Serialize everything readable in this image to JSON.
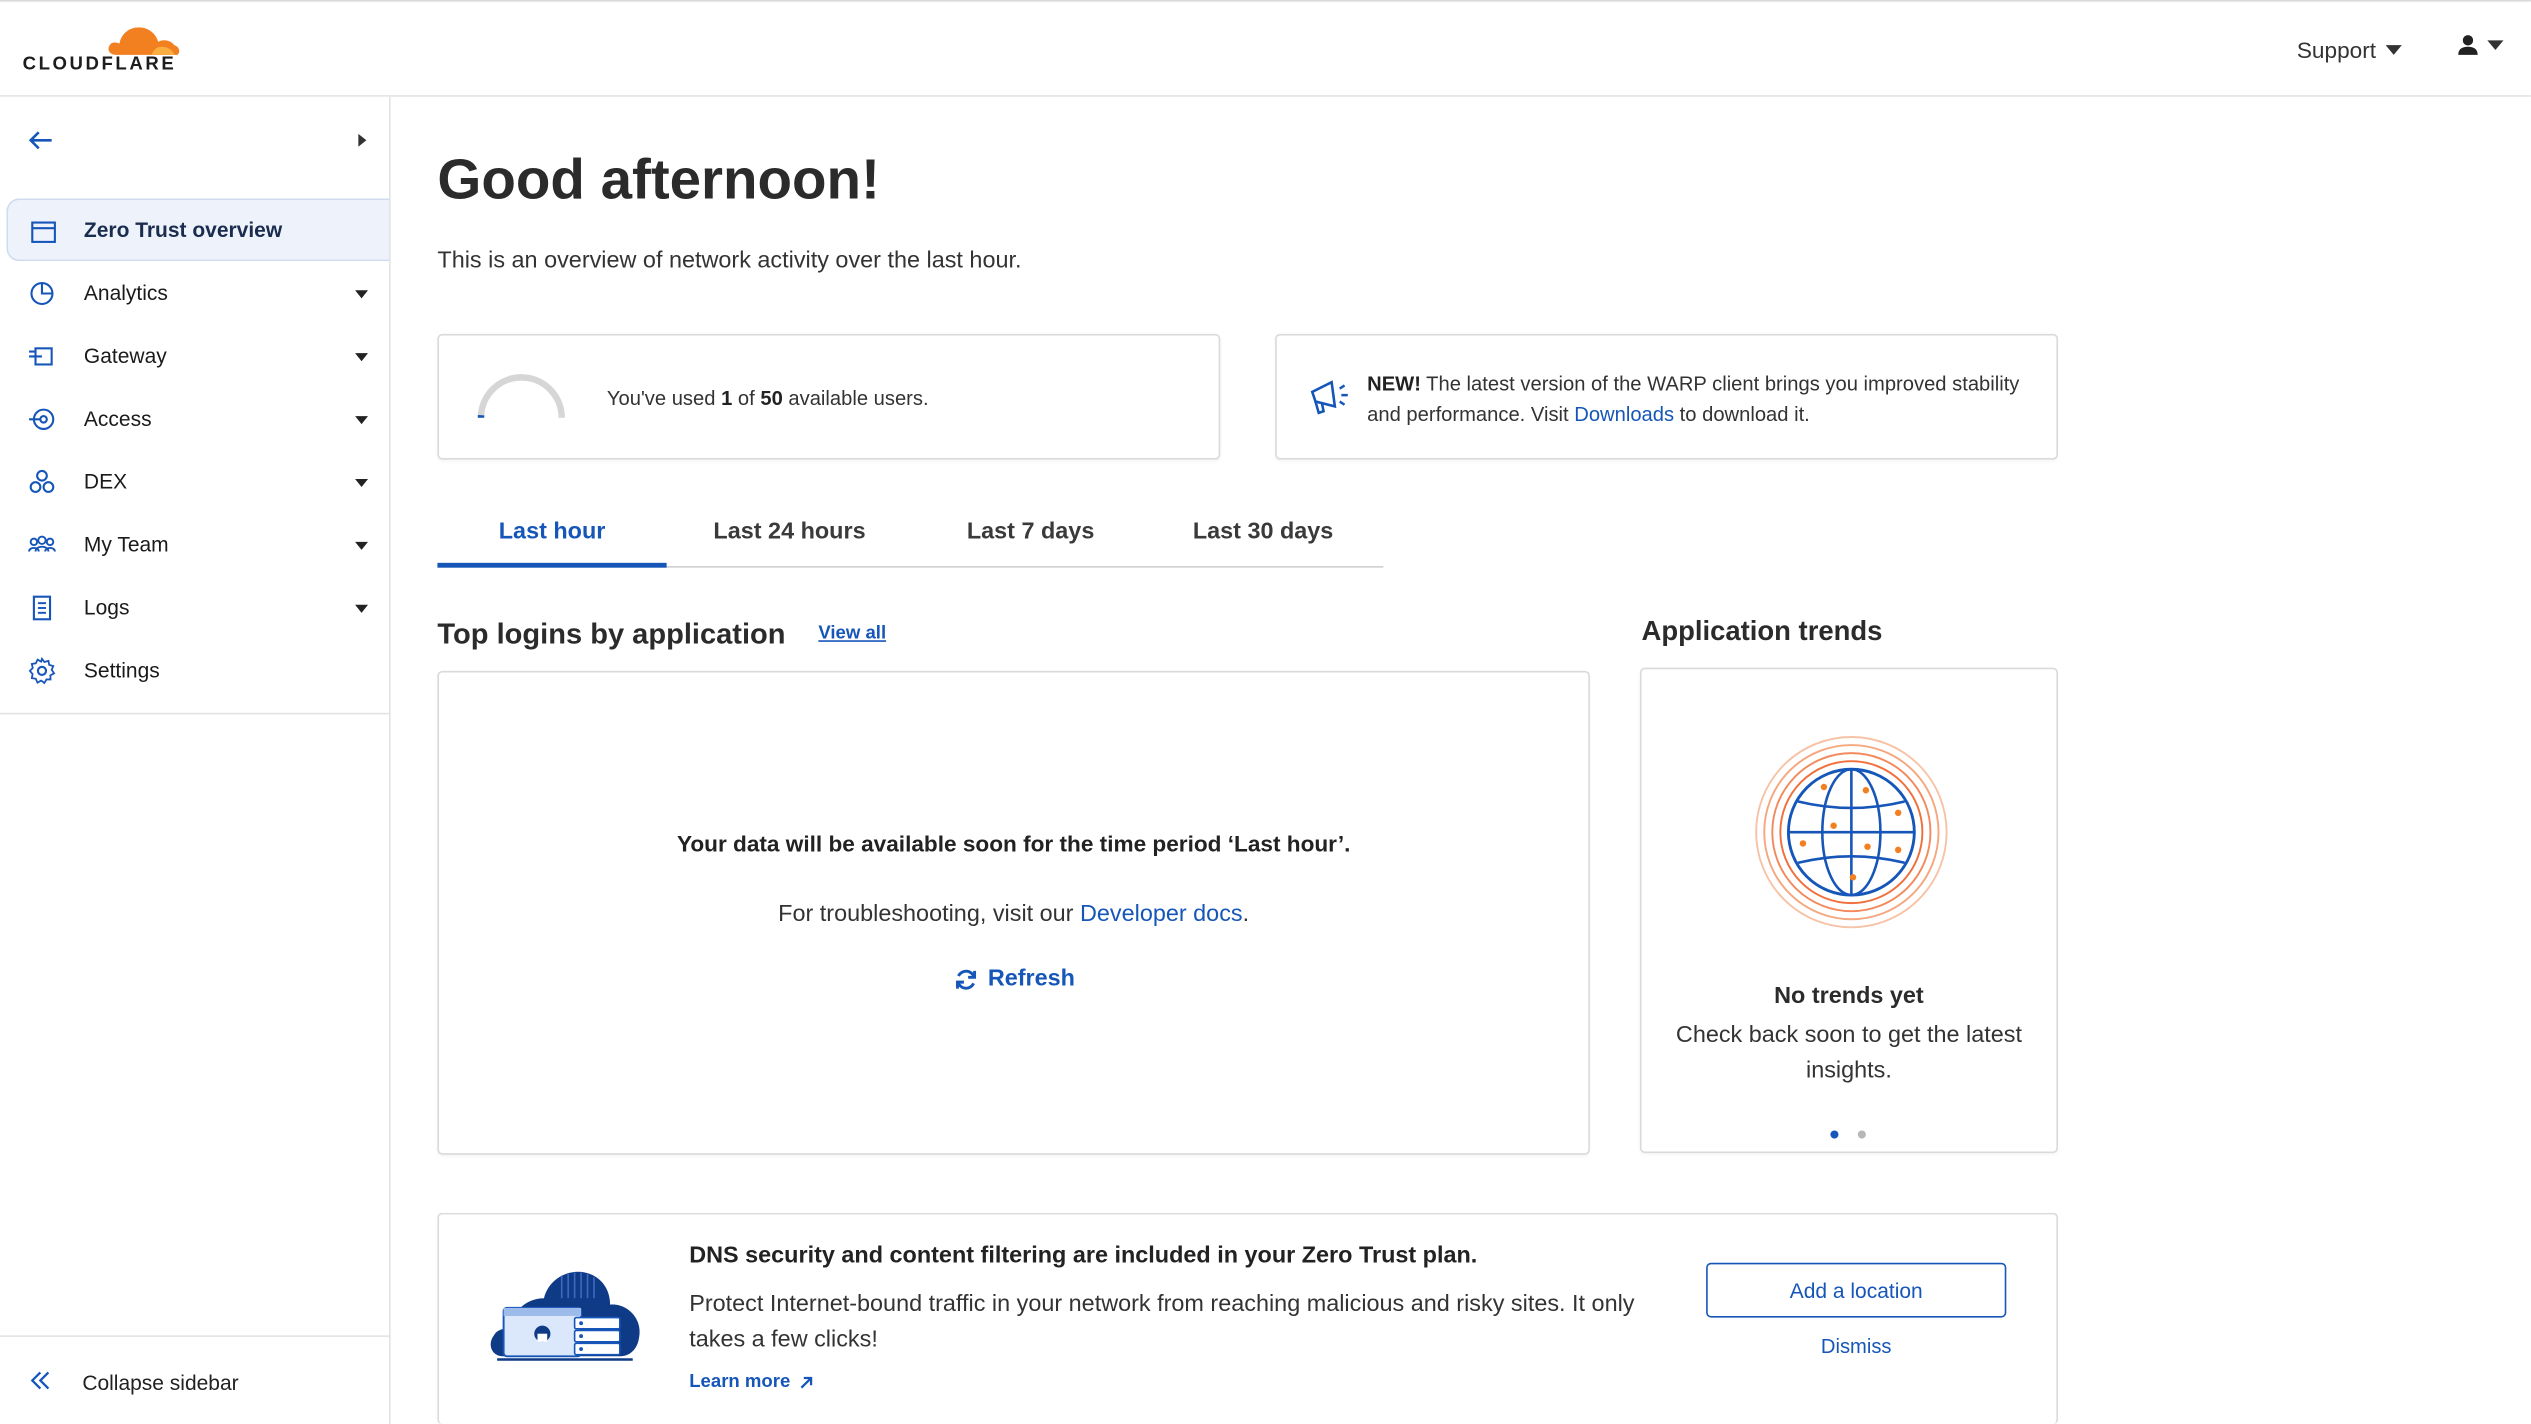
{
  "header": {
    "logo_text": "CLOUDFLARE",
    "support_label": "Support",
    "brand_color": "#f38020"
  },
  "sidebar": {
    "items": [
      {
        "label": "Zero Trust overview",
        "icon": "overview-icon",
        "active": true
      },
      {
        "label": "Analytics",
        "icon": "analytics-icon",
        "expandable": true
      },
      {
        "label": "Gateway",
        "icon": "gateway-icon",
        "expandable": true
      },
      {
        "label": "Access",
        "icon": "access-icon",
        "expandable": true
      },
      {
        "label": "DEX",
        "icon": "dex-icon",
        "expandable": true
      },
      {
        "label": "My Team",
        "icon": "team-icon",
        "expandable": true
      },
      {
        "label": "Logs",
        "icon": "logs-icon",
        "expandable": true
      },
      {
        "label": "Settings",
        "icon": "settings-icon"
      }
    ],
    "collapse_label": "Collapse sidebar"
  },
  "main": {
    "greeting": "Good afternoon!",
    "subtitle": "This is an overview of network activity over the last hour.",
    "usage": {
      "prefix": "You've used ",
      "used": "1",
      "middle": " of ",
      "total": "50",
      "suffix": " available users.",
      "fraction": 0.02
    },
    "warp": {
      "new_label": "NEW!",
      "text_before": " The latest version of the WARP client brings you improved stability and performance. Visit ",
      "link": "Downloads",
      "text_after": " to download it."
    },
    "tabs": [
      "Last hour",
      "Last 24 hours",
      "Last 7 days",
      "Last 30 days"
    ],
    "logins": {
      "title": "Top logins by application",
      "view_all": "View all",
      "empty_title": "Your data will be available soon for the time period ‘Last hour’.",
      "troubleshoot_prefix": "For troubleshooting, visit our ",
      "troubleshoot_link": "Developer docs",
      "troubleshoot_suffix": ".",
      "refresh": "Refresh"
    },
    "trends": {
      "title": "Application trends",
      "empty_title": "No trends yet",
      "empty_sub": "Check back soon to get the latest insights."
    },
    "dns": {
      "title": "DNS security and content filtering are included in your Zero Trust plan.",
      "body": "Protect Internet-bound traffic in your network from reaching malicious and risky sites. It only takes a few clicks!",
      "learn_more": "Learn more",
      "add_location": "Add a location",
      "dismiss": "Dismiss"
    }
  }
}
